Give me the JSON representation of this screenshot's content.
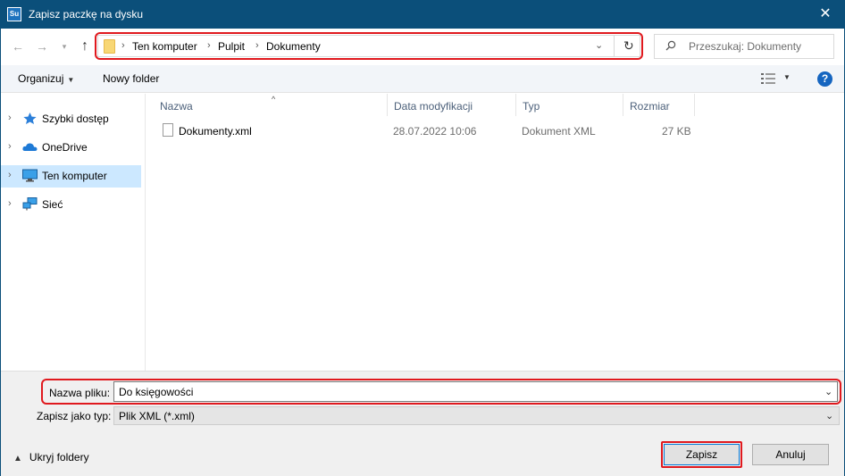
{
  "window": {
    "app_icon_text": "Su",
    "title": "Zapisz paczkę na dysku",
    "close_glyph": "✕"
  },
  "navigation": {
    "back_icon": "arrow-left-icon",
    "forward_icon": "arrow-right-icon",
    "recent_icon": "chevron-down-icon",
    "up_icon": "arrow-up-icon"
  },
  "address_bar": {
    "breadcrumbs": [
      "Ten komputer",
      "Pulpit",
      "Dokumenty"
    ],
    "separator": "›"
  },
  "search": {
    "placeholder": "Przeszukaj: Dokumenty"
  },
  "toolbar": {
    "organize_label": "Organizuj",
    "new_folder_label": "Nowy folder",
    "help_label": "?"
  },
  "nav_pane": {
    "items": [
      {
        "label": "Szybki dostęp",
        "icon": "star-icon"
      },
      {
        "label": "OneDrive",
        "icon": "cloud-icon"
      },
      {
        "label": "Ten komputer",
        "icon": "computer-icon",
        "selected": true
      },
      {
        "label": "Sieć",
        "icon": "network-icon"
      }
    ]
  },
  "file_list": {
    "columns": [
      "Nazwa",
      "Data modyfikacji",
      "Typ",
      "Rozmiar"
    ],
    "rows": [
      {
        "name": "Dokumenty.xml",
        "modified": "28.07.2022 10:06",
        "type": "Dokument XML",
        "size": "27 KB"
      }
    ]
  },
  "bottom": {
    "filename_label": "Nazwa pliku:",
    "filename_value": "Do księgowości",
    "filetype_label": "Zapisz jako typ:",
    "filetype_value": "Plik XML (*.xml)",
    "hide_folders_label": "Ukryj foldery",
    "save_label": "Zapisz",
    "cancel_label": "Anuluj"
  },
  "colors": {
    "titlebar": "#0b4f7a",
    "highlight": "#e0191e",
    "selection": "#cce8ff",
    "accent": "#0078d7"
  }
}
